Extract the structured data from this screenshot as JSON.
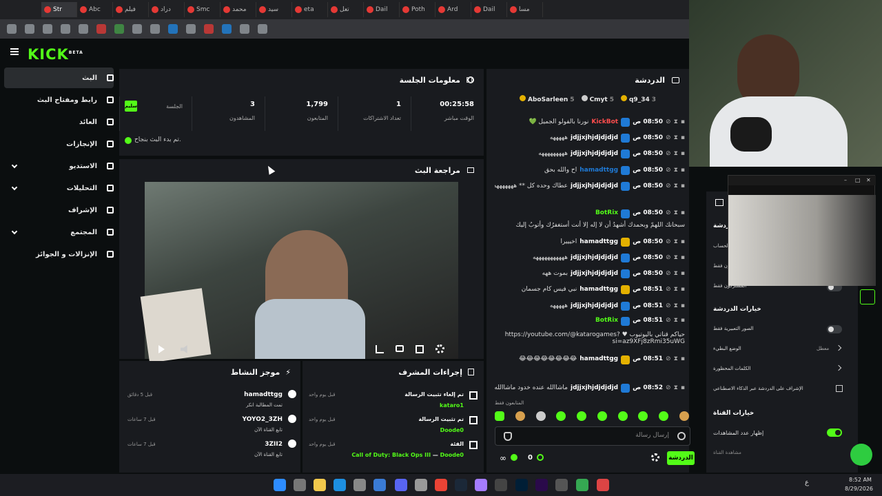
{
  "browser": {
    "tabs": [
      "Str",
      "Abc",
      "فيلم",
      "دراد",
      "Smc",
      "محمد",
      "سيد",
      "eta",
      "تعل",
      "Dail",
      "Poth",
      "Ard",
      "Dail",
      "مسا"
    ]
  },
  "header": {
    "logo": "KICK",
    "logo_tag": "BETA"
  },
  "sidebar": {
    "items": [
      {
        "label": "البث",
        "icon": "broadcast-icon"
      },
      {
        "label": "رابط ومفتاح البث",
        "icon": "link-icon"
      },
      {
        "label": "العائد",
        "icon": "dashboard-icon"
      },
      {
        "label": "الإنجازات",
        "icon": "trophy-icon"
      },
      {
        "label": "الاستديو",
        "icon": "studio-icon"
      },
      {
        "label": "التحليلات",
        "icon": "analytics-icon"
      },
      {
        "label": "الإشراف",
        "icon": "hammer-icon"
      },
      {
        "label": "المجتمع",
        "icon": "community-icon"
      },
      {
        "label": "الإنزالات و الجوائز",
        "icon": "gift-icon"
      }
    ]
  },
  "session": {
    "title": "معلومات الجلسة",
    "status_badge": "سليم",
    "stats": [
      {
        "value": "",
        "label": "الجلسة"
      },
      {
        "value": "3",
        "label": "المشاهدون"
      },
      {
        "value": "1,799",
        "label": "المتابعون"
      },
      {
        "value": "1",
        "label": "تعداد الاشتراكات"
      },
      {
        "value": "00:25:58",
        "label": "الوقت مباشر"
      }
    ],
    "success_msg": "تم بدء البث بنجاح."
  },
  "review": {
    "title": "مراجعة البث"
  },
  "activity": {
    "title": "موجز النشاط",
    "items": [
      {
        "user": "hamadttgg",
        "action": "تمت المطالبة انكر",
        "time": "قبل 5 دقائق"
      },
      {
        "user": "YOYO2_3ZH",
        "action": "تابع القناة الآن",
        "time": "قبل 7 ساعات"
      },
      {
        "user": "3ZII2",
        "action": "تابع القناة الآن",
        "time": "قبل 7 ساعات"
      }
    ]
  },
  "mod_actions": {
    "title": "إجراءات المشرف",
    "items": [
      {
        "title": "تم إلغاء تثبيت الرسالة",
        "by": "katarо1",
        "time": "قبل يوم واحد"
      },
      {
        "title": "تم تثبيت الرسالة",
        "by": "Doode0",
        "time": "قبل يوم واحد"
      },
      {
        "title": "الفئة",
        "detail": "Call of Duty: Black Ops III",
        "by": "Doode0",
        "time": "قبل يوم واحد"
      }
    ]
  },
  "chat": {
    "title": "الدردشة",
    "top_gifters": [
      {
        "name": "AboSarleen",
        "count": "5"
      },
      {
        "name": "Cmyt",
        "count": "5"
      },
      {
        "name": "q9_34",
        "count": "3"
      }
    ],
    "messages": [
      {
        "time": "08:50 ص",
        "user": "KickBot",
        "color": "#ff4d4d",
        "text": "نورنا بالفولو الجميل 💚"
      },
      {
        "time": "08:50 ص",
        "user": "jdjjxjhjdjdjdjd",
        "color": "#ffffff",
        "text": "هههههه"
      },
      {
        "time": "08:50 ص",
        "user": "jdjjxjhjdjdjdjd",
        "color": "#ffffff",
        "text": "هههههههههه"
      },
      {
        "time": "08:50 ص",
        "user": "hamadttgg",
        "color": "#1f7ad6",
        "text": "اح والله بحق"
      },
      {
        "time": "08:50 ص",
        "user": "jdjjxjhjdjdjdjd",
        "color": "#ffffff",
        "text": "عطاك وحده كل ** هههههههه"
      },
      {
        "time": "08:50 ص",
        "user": "BotRix",
        "color": "#53fc18",
        "text": "سبحانك اللهمّ وبحمدك أشهدُ أن لا إله إلا أنت أستغفرُك وأتوبُ إليك"
      },
      {
        "time": "08:50 ص",
        "user": "hamadttgg",
        "color": "#ffffff",
        "text": "اخيييرا"
      },
      {
        "time": "08:50 ص",
        "user": "jdjjxjhjdjdjdjd",
        "color": "#ffffff",
        "text": "هههههههههههه"
      },
      {
        "time": "08:50 ص",
        "user": "jdjjxjhjdjdjdjd",
        "color": "#ffffff",
        "text": "بموت ههه"
      },
      {
        "time": "08:51 ص",
        "user": "hamadttgg",
        "color": "#ffffff",
        "text": "نبي فيس كام جسمان"
      },
      {
        "time": "08:51 ص",
        "user": "jdjjxjhjdjdjdjd",
        "color": "#ffffff",
        "text": "هههههه"
      },
      {
        "time": "08:51 ص",
        "user": "BotRix",
        "color": "#53fc18",
        "text": "حياكم قناتي باليوتيوب ♥ https://youtube.com/@katarogames?si=az9XFj8zRmi35uWG"
      },
      {
        "time": "08:51 ص",
        "user": "hamadttgg",
        "color": "#ffffff",
        "text": "😂😂😂😂😂😂😂😂"
      },
      {
        "time": "08:52 ص",
        "user": "jdjjxjhjdjdjdjd",
        "color": "#ffffff",
        "text": "ماشاالله عنده خدود ماشاالله"
      }
    ],
    "followers_only": "المتابعون فقط",
    "input_placeholder": "إرسال رسالة",
    "send_label": "الدردشة",
    "count": "0"
  },
  "settings_panel": {
    "chat_heading": "الدردشة",
    "rows_top": [
      "الحساب",
      "المتابعون فقط",
      "المشتركون فقط"
    ],
    "chat_options_title": "خيارات الدردشة",
    "options": [
      {
        "label": "الصور التعبيرية فقط",
        "value": ""
      },
      {
        "label": "الوضع البطيء",
        "value": "معطل"
      },
      {
        "label": "الكلمات المحظورة",
        "value": ""
      },
      {
        "label": "الإشراف على الدردشة عبر الذكاء الاصطناعي",
        "value": ""
      }
    ],
    "channel_options_title": "خيارات القناة",
    "show_viewers": "إظهار عدد المشاهدات",
    "last": "مشاهدة القناة"
  },
  "taskbar": {
    "time": "8:52 AM",
    "date": "8/29/2026",
    "lang": "ع"
  }
}
